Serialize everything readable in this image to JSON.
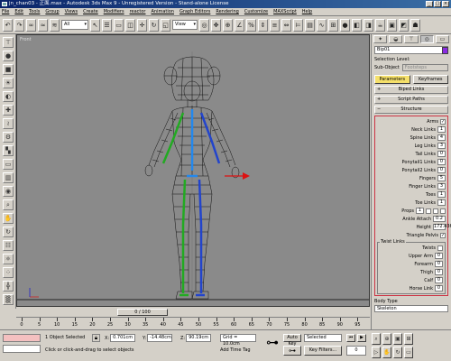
{
  "window": {
    "title": "jn_chan03 - 正面.max - Autodesk 3ds Max 9 - Unregistered Version - Stand-alone License",
    "controls": [
      "_",
      "□",
      "×"
    ]
  },
  "menu": [
    "File",
    "Edit",
    "Tools",
    "Group",
    "Views",
    "Create",
    "Modifiers",
    "reactor",
    "Animation",
    "Graph Editors",
    "Rendering",
    "Customize",
    "MAXScript",
    "Help"
  ],
  "toolbar": {
    "filter": "All",
    "coord": "View"
  },
  "viewport": {
    "label": "Front",
    "background": "#8a8a8a"
  },
  "timeline": {
    "slider": "0 / 100",
    "ticks": [
      "0",
      "5",
      "10",
      "15",
      "20",
      "25",
      "30",
      "35",
      "40",
      "45",
      "50",
      "55",
      "60",
      "65",
      "70",
      "75",
      "80",
      "85",
      "90",
      "95"
    ]
  },
  "command_panel": {
    "name_field": "Bip01",
    "selection_level_label": "Selection Level:",
    "sub_object_label": "Sub-Object",
    "sub_object_value": "Footsteps",
    "btn_parameters": "Parameters",
    "btn_keyframes": "Keyframes",
    "rollouts": [
      "Biped Links",
      "Script Paths",
      "Structure"
    ],
    "params": [
      {
        "label": "Arms",
        "type": "check",
        "value": "✓"
      },
      {
        "label": "Neck Links",
        "type": "spin",
        "value": "1"
      },
      {
        "label": "Spine Links",
        "type": "spin",
        "value": "4"
      },
      {
        "label": "Leg Links",
        "type": "spin",
        "value": "3"
      },
      {
        "label": "Tail Links",
        "type": "spin",
        "value": "0"
      },
      {
        "label": "Ponytail1 Links",
        "type": "spin",
        "value": "0"
      },
      {
        "label": "Ponytail2 Links",
        "type": "spin",
        "value": "0"
      },
      {
        "label": "Fingers",
        "type": "spin",
        "value": "5"
      },
      {
        "label": "Finger Links",
        "type": "spin",
        "value": "3"
      },
      {
        "label": "Toes",
        "type": "spin",
        "value": "1"
      },
      {
        "label": "Toe Links",
        "type": "spin",
        "value": "1"
      },
      {
        "label": "Props",
        "type": "props",
        "value": "1"
      },
      {
        "label": "Ankle Attach",
        "type": "spinw",
        "value": "0.2"
      },
      {
        "label": "Height",
        "type": "spinw",
        "value": "172.436"
      },
      {
        "label": "Triangle Pelvis",
        "type": "check",
        "value": "✓"
      }
    ],
    "twist_group": {
      "label": "Twist Links",
      "items": [
        {
          "label": "Twists",
          "type": "check",
          "value": ""
        },
        {
          "label": "Upper Arm",
          "type": "spin",
          "value": "0"
        },
        {
          "label": "Forearm",
          "type": "spin",
          "value": "0"
        },
        {
          "label": "Thigh",
          "type": "spin",
          "value": "0"
        },
        {
          "label": "Calf",
          "type": "spin",
          "value": "0"
        },
        {
          "label": "Horse Link",
          "type": "spin",
          "value": "0"
        }
      ]
    },
    "body_type_label": "Body Type",
    "body_type_value": "Skeleton"
  },
  "status": {
    "selected": "1 Object Selected",
    "prompt": "Click or click-and-drag to select objects",
    "x_label": "X:",
    "x": "0.701cm",
    "y_label": "Y:",
    "y": "-14.48cm",
    "z_label": "Z:",
    "z": "90.19cm",
    "grid": "Grid = 10.0cm",
    "add_tag": "Add Time Tag",
    "auto_key": "Auto Key",
    "set_key": "⊶",
    "selected_dd": "Selected",
    "key_filters": "Key Filters...",
    "frame": "0"
  },
  "colors": {
    "title_bar": "#0a246a",
    "panel_highlight": "#f5e06a",
    "panel_border": "#cc3344",
    "listener": "#f4c0c0",
    "wire": "#111111",
    "limb_left": "#22aa22",
    "limb_right": "#2244cc",
    "spine": "#2288ee",
    "gizmo": "#dd1111"
  }
}
